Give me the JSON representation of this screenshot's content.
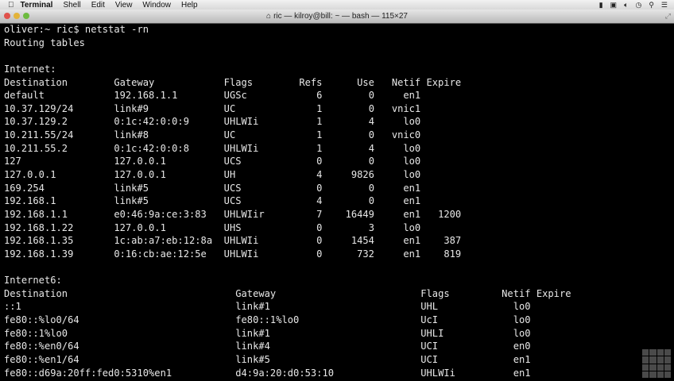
{
  "menubar": {
    "app": "Terminal",
    "items": [
      "Shell",
      "Edit",
      "View",
      "Window",
      "Help"
    ]
  },
  "window": {
    "title": "ric — kilroy@bill: ~ — bash — 115×27"
  },
  "terminal": {
    "prompt_line": "oliver:~ ric$ netstat -rn",
    "heading": "Routing tables",
    "inet": {
      "label": "Internet:",
      "headers": [
        "Destination",
        "Gateway",
        "Flags",
        "Refs",
        "Use",
        "Netif",
        "Expire"
      ],
      "rows": [
        [
          "default",
          "192.168.1.1",
          "UGSc",
          "6",
          "0",
          "en1",
          ""
        ],
        [
          "10.37.129/24",
          "link#9",
          "UC",
          "1",
          "0",
          "vnic1",
          ""
        ],
        [
          "10.37.129.2",
          "0:1c:42:0:0:9",
          "UHLWIi",
          "1",
          "4",
          "lo0",
          ""
        ],
        [
          "10.211.55/24",
          "link#8",
          "UC",
          "1",
          "0",
          "vnic0",
          ""
        ],
        [
          "10.211.55.2",
          "0:1c:42:0:0:8",
          "UHLWIi",
          "1",
          "4",
          "lo0",
          ""
        ],
        [
          "127",
          "127.0.0.1",
          "UCS",
          "0",
          "0",
          "lo0",
          ""
        ],
        [
          "127.0.0.1",
          "127.0.0.1",
          "UH",
          "4",
          "9826",
          "lo0",
          ""
        ],
        [
          "169.254",
          "link#5",
          "UCS",
          "0",
          "0",
          "en1",
          ""
        ],
        [
          "192.168.1",
          "link#5",
          "UCS",
          "4",
          "0",
          "en1",
          ""
        ],
        [
          "192.168.1.1",
          "e0:46:9a:ce:3:83",
          "UHLWIir",
          "7",
          "16449",
          "en1",
          "1200"
        ],
        [
          "192.168.1.22",
          "127.0.0.1",
          "UHS",
          "0",
          "3",
          "lo0",
          ""
        ],
        [
          "192.168.1.35",
          "1c:ab:a7:eb:12:8a",
          "UHLWIi",
          "0",
          "1454",
          "en1",
          "387"
        ],
        [
          "192.168.1.39",
          "0:16:cb:ae:12:5e",
          "UHLWIi",
          "0",
          "732",
          "en1",
          "819"
        ]
      ]
    },
    "inet6": {
      "label": "Internet6:",
      "headers": [
        "Destination",
        "Gateway",
        "Flags",
        "Netif",
        "Expire"
      ],
      "rows": [
        [
          "::1",
          "link#1",
          "UHL",
          "lo0",
          ""
        ],
        [
          "fe80::%lo0/64",
          "fe80::1%lo0",
          "UcI",
          "lo0",
          ""
        ],
        [
          "fe80::1%lo0",
          "link#1",
          "UHLI",
          "lo0",
          ""
        ],
        [
          "fe80::%en0/64",
          "link#4",
          "UCI",
          "en0",
          ""
        ],
        [
          "fe80::%en1/64",
          "link#5",
          "UCI",
          "en1",
          ""
        ],
        [
          "fe80::d69a:20ff:fed0:5310%en1",
          "d4:9a:20:d0:53:10",
          "UHLWIi",
          "en1",
          ""
        ]
      ]
    }
  }
}
